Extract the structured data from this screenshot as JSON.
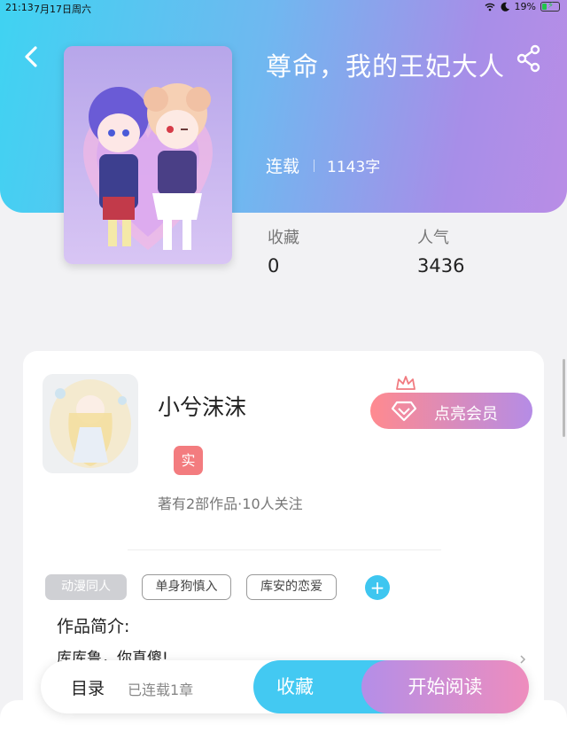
{
  "status_bar": {
    "time": "21:13",
    "date": "7月17日周六",
    "battery": "19%"
  },
  "book": {
    "title": "尊命，我的王妃大人",
    "status": "连载",
    "word_count": "1143字",
    "cover_image": "anime-couple-cover"
  },
  "stats": {
    "favorites_label": "收藏",
    "favorites_value": "0",
    "popularity_label": "人气",
    "popularity_value": "3436"
  },
  "author": {
    "name": "小兮沫沫",
    "badge": "实",
    "summary": "著有2部作品·10人关注",
    "vip_label": "点亮会员"
  },
  "tags": [
    "动漫同人",
    "单身狗慎入",
    "库安的恋爱"
  ],
  "intro": {
    "heading": "作品简介:",
    "text": "库库鲁，你真傻!"
  },
  "bottom_bar": {
    "toc_label": "目录",
    "chapter_count": "已连载1章",
    "collect_label": "收藏",
    "read_label": "开始阅读"
  },
  "colors": {
    "accent_blue": "#43c9f2",
    "accent_purple": "#b48ee8",
    "badge_red": "#f37c7f"
  }
}
